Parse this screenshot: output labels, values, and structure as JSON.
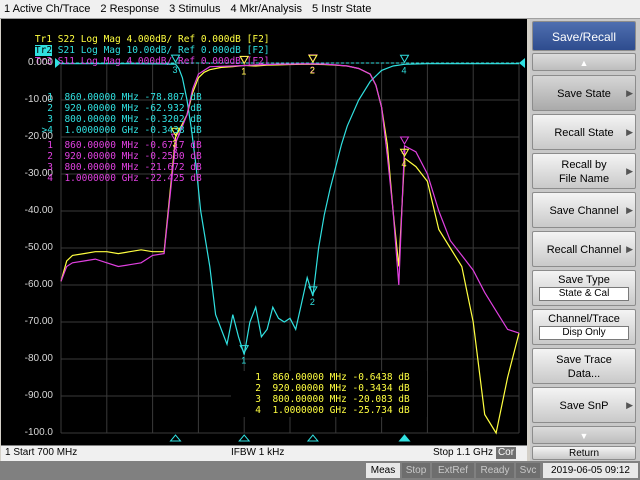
{
  "menu": [
    "1 Active Ch/Trace",
    "2 Response",
    "3 Stimulus",
    "4 Mkr/Analysis",
    "5 Instr State"
  ],
  "traces": [
    {
      "id": "Tr1",
      "param": "S22",
      "fmt": "Log Mag",
      "scale": "4.000dB/",
      "ref": "Ref 0.000dB",
      "win": "[F2]",
      "color": "#ffff40"
    },
    {
      "id": "Tr2",
      "param": "S21",
      "fmt": "Log Mag",
      "scale": "10.00dB/",
      "ref": "Ref 0.000dB",
      "win": "[F2]",
      "color": "#30e0e0"
    },
    {
      "id": "Tr3",
      "param": "S11",
      "fmt": "Log Mag",
      "scale": "4.000dB/",
      "ref": "Ref 0.000dB",
      "win": "[F2]",
      "color": "#e040e0"
    }
  ],
  "y_axis": [
    "0.000",
    "-10.00",
    "-20.00",
    "-30.00",
    "-40.00",
    "-50.00",
    "-60.00",
    "-70.00",
    "-80.00",
    "-90.00",
    "-100.0"
  ],
  "marker_tables": [
    {
      "color": "#30e0e0",
      "rows": [
        {
          "n": "1",
          "freq": "860.00000 MHz",
          "val": "-78.807 dB"
        },
        {
          "n": "2",
          "freq": "920.00000 MHz",
          "val": "-62.932 dB"
        },
        {
          "n": "3",
          "freq": "800.00000 MHz",
          "val": "-0.3202 dB"
        },
        {
          "n": ">4",
          "freq": "1.0000000 GHz",
          "val": "-0.3438 dB"
        }
      ]
    },
    {
      "color": "#e040e0",
      "rows": [
        {
          "n": "1",
          "freq": "860.00000 MHz",
          "val": "-0.6717 dB"
        },
        {
          "n": "2",
          "freq": "920.00000 MHz",
          "val": "-0.2500 dB"
        },
        {
          "n": "3",
          "freq": "800.00000 MHz",
          "val": "-21.672 dB"
        },
        {
          "n": "4",
          "freq": "1.0000000 GHz",
          "val": "-22.425 dB"
        }
      ]
    },
    {
      "color": "#ffff40",
      "rows": [
        {
          "n": "1",
          "freq": "860.00000 MHz",
          "val": "-0.6438 dB"
        },
        {
          "n": "2",
          "freq": "920.00000 MHz",
          "val": "-0.3434 dB"
        },
        {
          "n": "3",
          "freq": "800.00000 MHz",
          "val": "-20.083 dB"
        },
        {
          "n": "4",
          "freq": "1.0000000 GHz",
          "val": "-25.734 dB"
        }
      ]
    }
  ],
  "status": {
    "start": "1 Start 700 MHz",
    "ifbw": "IFBW 1 kHz",
    "stop": "Stop 1.1 GHz",
    "cor": "Cor"
  },
  "sysbar": {
    "items": [
      "Meas",
      "Stop",
      "ExtRef",
      "Ready",
      "Svc"
    ],
    "clock": "2019-06-05 09:12"
  },
  "softkeys": {
    "title": "Save/Recall",
    "save_state": "Save State",
    "recall_state": "Recall State",
    "recall_by_file_name": "Recall by File Name",
    "save_channel": "Save Channel",
    "recall_channel": "Recall Channel",
    "save_type": "Save Type",
    "save_type_value": "State & Cal",
    "channel_trace": "Channel/Trace",
    "channel_trace_value": "Disp Only",
    "save_trace_data": "Save Trace Data...",
    "save_snp": "Save SnP",
    "return": "Return"
  },
  "colors": {
    "s22": "#ffff40",
    "s21": "#30e0e0",
    "s11": "#e040e0",
    "grid": "#3a3a3a",
    "ref_line": "#30e0e0"
  },
  "chart_data": {
    "type": "line",
    "x_unit": "MHz",
    "xlim": [
      700,
      1100
    ],
    "y_unit": "dB",
    "ylim": [
      -100,
      0
    ],
    "series": [
      {
        "name": "S21",
        "x": [
          700,
          728,
          760,
          790,
          795,
          800,
          803,
          806,
          810,
          814,
          818,
          822,
          830,
          835,
          840,
          845,
          850,
          855,
          860,
          865,
          870,
          875,
          880,
          885,
          890,
          895,
          900,
          905,
          910,
          915,
          920,
          925,
          930,
          935,
          940,
          945,
          950,
          960,
          970,
          980,
          990,
          1000,
          1020,
          1050,
          1100
        ],
        "y": [
          -0.2,
          -0.2,
          -0.2,
          -0.25,
          -0.3,
          -0.3,
          -1.5,
          -4,
          -10,
          -18,
          -28,
          -40,
          -55,
          -68,
          -72,
          -76,
          -68,
          -74,
          -78.8,
          -70,
          -66,
          -74,
          -72,
          -66,
          -69,
          -70,
          -69,
          -72,
          -65,
          -58,
          -63,
          -50,
          -41,
          -34,
          -28,
          -22,
          -17,
          -10,
          -5,
          -2,
          -0.8,
          -0.34,
          -0.2,
          -0.2,
          -0.2
        ]
      },
      {
        "name": "S22",
        "x": [
          700,
          705,
          710,
          720,
          730,
          740,
          750,
          760,
          770,
          780,
          790,
          800,
          810,
          815,
          820,
          825,
          830,
          840,
          850,
          860,
          870,
          880,
          890,
          900,
          910,
          920,
          930,
          940,
          950,
          960,
          970,
          975,
          980,
          985,
          990,
          995,
          1000,
          1010,
          1020,
          1030,
          1040,
          1050,
          1060,
          1070,
          1080,
          1090,
          1100
        ],
        "y": [
          -59,
          -53.5,
          -52,
          -51.5,
          -51,
          -51,
          -51.5,
          -51,
          -50.5,
          -51,
          -51,
          -20.1,
          -14,
          -8,
          -4,
          -2.5,
          -1.8,
          -1.2,
          -1,
          -0.64,
          -0.8,
          -0.6,
          -0.5,
          -0.4,
          -0.35,
          -0.34,
          -0.4,
          -0.6,
          -0.8,
          -1.5,
          -3,
          -6,
          -12,
          -22,
          -40,
          -55,
          -25.7,
          -28,
          -32,
          -45,
          -50,
          -55,
          -70,
          -95,
          -100,
          -85,
          -73
        ]
      },
      {
        "name": "S11",
        "x": [
          700,
          705,
          710,
          720,
          730,
          740,
          750,
          760,
          770,
          780,
          790,
          800,
          810,
          815,
          820,
          825,
          830,
          840,
          850,
          860,
          870,
          880,
          890,
          900,
          910,
          920,
          930,
          940,
          950,
          960,
          970,
          975,
          980,
          985,
          990,
          995,
          1000,
          1010,
          1020,
          1030,
          1040,
          1050,
          1060,
          1070,
          1080,
          1090,
          1100
        ],
        "y": [
          -59,
          -55,
          -54,
          -53.5,
          -53,
          -54,
          -55,
          -54.5,
          -54,
          -52,
          -51.5,
          -21.7,
          -14,
          -7,
          -3,
          -2,
          -1,
          -0.9,
          -0.8,
          -0.67,
          -0.5,
          -0.4,
          -0.3,
          -0.3,
          -0.25,
          -0.25,
          -0.3,
          -0.5,
          -0.8,
          -1.5,
          -3,
          -6,
          -12,
          -25,
          -40,
          -60,
          -22.4,
          -24,
          -30,
          -40,
          -48,
          -52,
          -56,
          -62,
          -67,
          -72,
          -73
        ]
      }
    ],
    "markers": [
      {
        "trace": "S21",
        "n": "1",
        "x": 860,
        "y": -78.807
      },
      {
        "trace": "S21",
        "n": "2",
        "x": 920,
        "y": -62.932
      },
      {
        "trace": "S21",
        "n": "3",
        "x": 800,
        "y": -0.3202
      },
      {
        "trace": "S21",
        "n": "4",
        "x": 1000,
        "y": -0.3438
      },
      {
        "trace": "S11",
        "n": "1",
        "x": 860,
        "y": -0.6717
      },
      {
        "trace": "S11",
        "n": "2",
        "x": 920,
        "y": -0.25
      },
      {
        "trace": "S11",
        "n": "3",
        "x": 800,
        "y": -21.672
      },
      {
        "trace": "S11",
        "n": "4",
        "x": 1000,
        "y": -22.425
      },
      {
        "trace": "S22",
        "n": "1",
        "x": 860,
        "y": -0.6438
      },
      {
        "trace": "S22",
        "n": "2",
        "x": 920,
        "y": -0.3434
      },
      {
        "trace": "S22",
        "n": "3",
        "x": 800,
        "y": -20.083
      },
      {
        "trace": "S22",
        "n": "4",
        "x": 1000,
        "y": -25.734
      }
    ],
    "grid": true
  }
}
